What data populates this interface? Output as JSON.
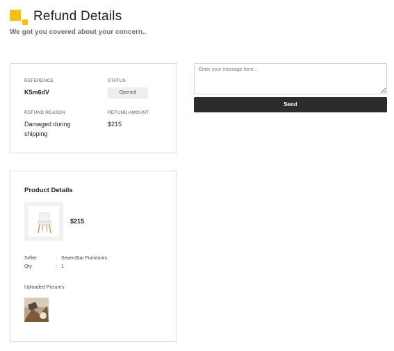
{
  "header": {
    "title": "Refund Details",
    "subtitle": "We got you covered about your concern..",
    "logo_color": "#F4C20D"
  },
  "refund": {
    "reference_label": "REFERENCE",
    "reference_value": "K5m6dV",
    "status_label": "STATUS",
    "status_value": "Opened",
    "reason_label": "REFUND REASON",
    "reason_value": "Damaged during shipping",
    "amount_label": "REFUND AMOUNT",
    "amount_value": "$215"
  },
  "product": {
    "section_title": "Product Details",
    "price": "$215",
    "seller_label": "Seller",
    "seller_value": "SevenStar Furnitures",
    "qty_label": "Qty",
    "qty_value": "1",
    "separator": ":",
    "uploaded_label": "Uploaded Pictures:",
    "image_icon": "chair-icon"
  },
  "message": {
    "placeholder": "Enter your message here...",
    "value": "",
    "send_label": "Send",
    "button_color": "#2c2c2c"
  }
}
